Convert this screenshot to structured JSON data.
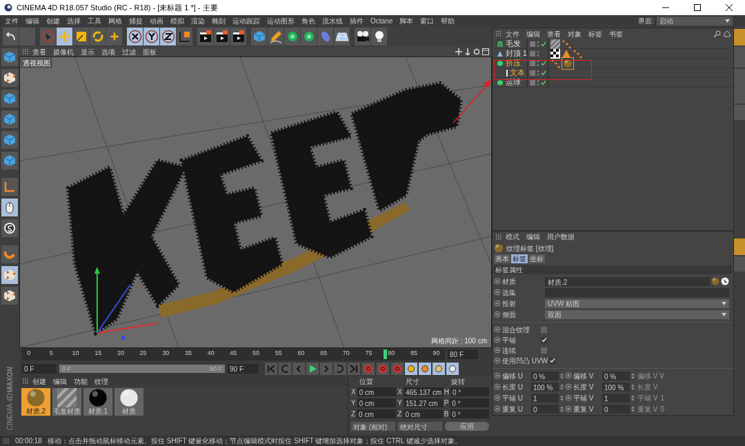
{
  "window": {
    "title": "CINEMA 4D R18.057 Studio (RC - R18) - [未标题 1 *] - 主要"
  },
  "menu": [
    "文件",
    "编辑",
    "创建",
    "选择",
    "工具",
    "网格",
    "捕捉",
    "动画",
    "模拟",
    "渲染",
    "雕刻",
    "运动跟踪",
    "运动图形",
    "角色",
    "流水线",
    "插件",
    "Octane",
    "脚本",
    "窗口",
    "帮助"
  ],
  "brand": [
    "MAXON",
    "CINEMA 4D"
  ],
  "layout_selector": {
    "label": "界面:",
    "value": "启动"
  },
  "toolbar": [
    {
      "kind": "undo",
      "selected": false
    },
    {
      "kind": "blank",
      "selected": false
    },
    {
      "kind": "select",
      "selected": false
    },
    {
      "kind": "move",
      "selected": true
    },
    {
      "kind": "scale",
      "selected": false
    },
    {
      "kind": "rotate",
      "selected": false
    },
    {
      "kind": "add",
      "selected": false
    },
    {
      "kind": "x",
      "selected": true
    },
    {
      "kind": "y",
      "selected": true
    },
    {
      "kind": "z",
      "selected": true
    },
    {
      "kind": "coord",
      "selected": false
    },
    {
      "kind": "clap",
      "selected": false
    },
    {
      "kind": "clap",
      "selected": false
    },
    {
      "kind": "clap",
      "selected": false
    },
    {
      "kind": "cube",
      "selected": false
    },
    {
      "kind": "pen",
      "selected": false
    },
    {
      "kind": "gem",
      "selected": false
    },
    {
      "kind": "gem",
      "selected": false
    },
    {
      "kind": "capsule",
      "selected": false
    },
    {
      "kind": "floor",
      "selected": false
    },
    {
      "kind": "camera",
      "selected": false
    },
    {
      "kind": "bulb",
      "selected": false
    }
  ],
  "left_tools": [
    {
      "kind": "cube",
      "selected": false
    },
    {
      "kind": "checker",
      "selected": false
    },
    {
      "kind": "cube",
      "selected": false
    },
    {
      "kind": "cube",
      "selected": false
    },
    {
      "kind": "cube",
      "selected": false
    },
    {
      "kind": "cube",
      "selected": false
    },
    {
      "kind": "axis",
      "selected": false
    },
    {
      "kind": "mouse",
      "selected": true
    },
    {
      "kind": "snap",
      "selected": false
    },
    {
      "kind": "magnet",
      "selected": false
    },
    {
      "kind": "checker",
      "selected": true
    },
    {
      "kind": "checker",
      "selected": false
    }
  ],
  "viewport": {
    "menu": [
      "查看",
      "摄像机",
      "显示",
      "选项",
      "过滤",
      "面板"
    ],
    "label": "透视视图",
    "grid_spacing": "网格间距 : 100 cm"
  },
  "timeline": {
    "ticks": [
      "0",
      "5",
      "10",
      "15",
      "20",
      "25",
      "30",
      "35",
      "40",
      "45",
      "50",
      "55",
      "60",
      "65",
      "70",
      "75",
      "80",
      "85",
      "90"
    ],
    "playhead": {
      "level": 0.8889
    },
    "range": {
      "level": 1
    },
    "current": "80 F",
    "start": "0 F",
    "range_start": "0 F",
    "range_end": "90 F",
    "end": "90 F"
  },
  "materials": {
    "menu": [
      "创建",
      "编辑",
      "功能",
      "纹理"
    ],
    "items": [
      {
        "name": "材质.2",
        "kind": "gold",
        "selected": true
      },
      {
        "name": "毛发材质",
        "kind": "hair",
        "selected": false
      },
      {
        "name": "材质.1",
        "kind": "black",
        "selected": false
      },
      {
        "name": "材质",
        "kind": "white",
        "selected": false
      }
    ]
  },
  "coordinates": {
    "headers": [
      "位置",
      "尺寸",
      "旋转"
    ],
    "rows": [
      [
        "X",
        "0 cm",
        "X",
        "465.137 cm",
        "H",
        "0 °"
      ],
      [
        "Y",
        "0 cm",
        "Y",
        "151.27 cm",
        "P",
        "0 °"
      ],
      [
        "Z",
        "0 cm",
        "Z",
        "0 cm",
        "B",
        "0 °"
      ]
    ],
    "mode": "对象 (相对)",
    "size_mode": "绝对尺寸",
    "apply": "应用"
  },
  "status_bar": {
    "time": "00:00:18",
    "message": "移动：点击并拖动鼠标移动元素。按住 SHIFT 键量化移动；节点编辑模式时按住 SHIFT 键增加选择对象；按住 CTRL 键减少选择对象。"
  },
  "object_manager": {
    "menu": [
      "文件",
      "编辑",
      "查看",
      "对象",
      "标签",
      "书签"
    ],
    "objects": [
      {
        "name": "毛发",
        "kind": "hair",
        "selected": false,
        "enabled": true,
        "tags": [
          {
            "kind": "stripes"
          },
          {
            "kind": "dots"
          }
        ]
      },
      {
        "name": "封顶 1",
        "kind": "cone",
        "selected": false,
        "enabled": false,
        "tags": [
          {
            "kind": "checker"
          },
          {
            "kind": "cone"
          },
          {
            "kind": "dots"
          }
        ]
      },
      {
        "name": "挤压",
        "kind": "extrude",
        "selected": true,
        "enabled": true,
        "tags": [
          {
            "kind": "dots"
          },
          {
            "kind": "material"
          }
        ],
        "children": [
          {
            "name": "文本",
            "kind": "text",
            "selected": true,
            "enabled": true
          }
        ]
      },
      {
        "name": "运球",
        "kind": "extrude",
        "selected": false,
        "enabled": true
      }
    ]
  },
  "attributes": {
    "menu": [
      "模式",
      "编辑",
      "用户数据"
    ],
    "title": "纹理标签 [纹理]",
    "tabs": [
      {
        "label": "基本",
        "selected": false
      },
      {
        "label": "标签",
        "selected": true
      },
      {
        "label": "坐标",
        "selected": false
      }
    ],
    "section": "标签属性",
    "fields": [
      {
        "label": "材质",
        "kind": "link",
        "value": "材质.2"
      },
      {
        "label": "选集",
        "kind": "text"
      },
      {
        "label": "投射",
        "kind": "dropdown",
        "value": "UVW 贴图"
      },
      {
        "label": "侧面",
        "kind": "dropdown",
        "value": "双面"
      }
    ],
    "checks": [
      {
        "label": "混合纹理",
        "checked": false
      },
      {
        "label": "平铺",
        "checked": true
      },
      {
        "label": "连续",
        "checked": false
      },
      {
        "label": "使用凹凸 UVW",
        "checked": true
      }
    ],
    "numbers": [
      [
        {
          "label": "偏移 U",
          "value": "0 %"
        },
        {
          "label": "偏移 V",
          "value": "0 %"
        }
      ],
      [
        {
          "label": "长度 U",
          "value": "100 %"
        },
        {
          "label": "长度 V",
          "value": "100 %"
        }
      ],
      [
        {
          "label": "平铺 U",
          "value": "1"
        },
        {
          "label": "平铺 V",
          "value": "1"
        }
      ],
      [
        {
          "label": "重复 U",
          "value": "0"
        },
        {
          "label": "重复 V",
          "value": "0"
        }
      ]
    ],
    "ghost": [
      {
        "label": "偏移 V V"
      },
      {
        "label": "长度 V"
      },
      {
        "label": "平铺 V",
        "value": "1"
      },
      {
        "label": "重复 V",
        "value": "0"
      }
    ]
  }
}
